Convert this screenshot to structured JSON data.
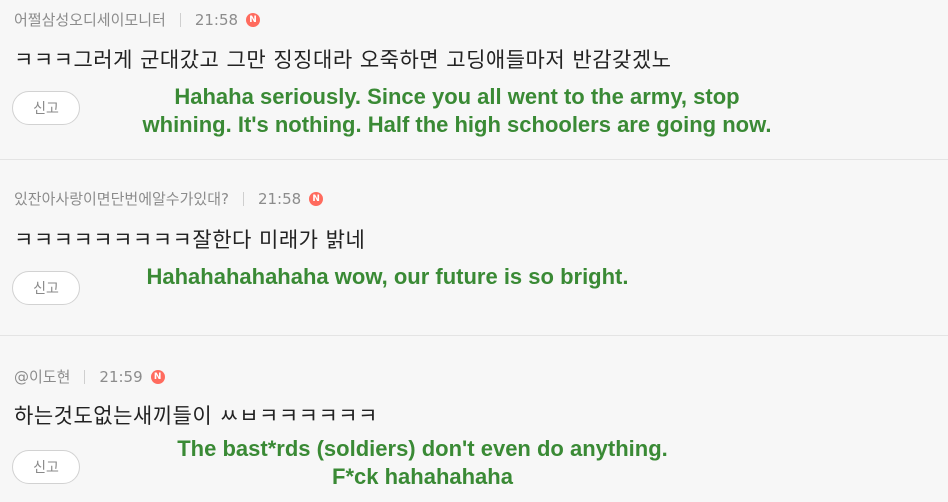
{
  "comments": [
    {
      "author": "어쩔삼성오디세이모니터",
      "time": "21:58",
      "badge": "N",
      "text": "ㅋㅋㅋ그러게 군대갔고 그만 징징대라 오죽하면 고딩애들마저 반감갖겠노",
      "report_label": "신고",
      "translation_line1": "Hahaha seriously. Since you all went to the army, stop",
      "translation_line2": "whining. It's nothing. Half the high schoolers are going now."
    },
    {
      "author": "있잔아사랑이면단번에알수가있대?",
      "time": "21:58",
      "badge": "N",
      "text": "ㅋㅋㅋㅋㅋㅋㅋㅋㅋ잘한다 미래가 밝네",
      "report_label": "신고",
      "translation_line1": "Hahahahahahaha wow, our future is so bright."
    },
    {
      "author": "@이도현",
      "time": "21:59",
      "badge": "N",
      "text": "하는것도없는새끼들이 ㅆㅂㅋㅋㅋㅋㅋㅋ",
      "report_label": "신고",
      "translation_line1": "The bast*rds (soldiers) don't even do anything.",
      "translation_line2": "F*ck hahahahaha"
    }
  ],
  "colors": {
    "background": "#f7f7f7",
    "translation": "#3a8a35",
    "badge": "#ff6b5e"
  }
}
